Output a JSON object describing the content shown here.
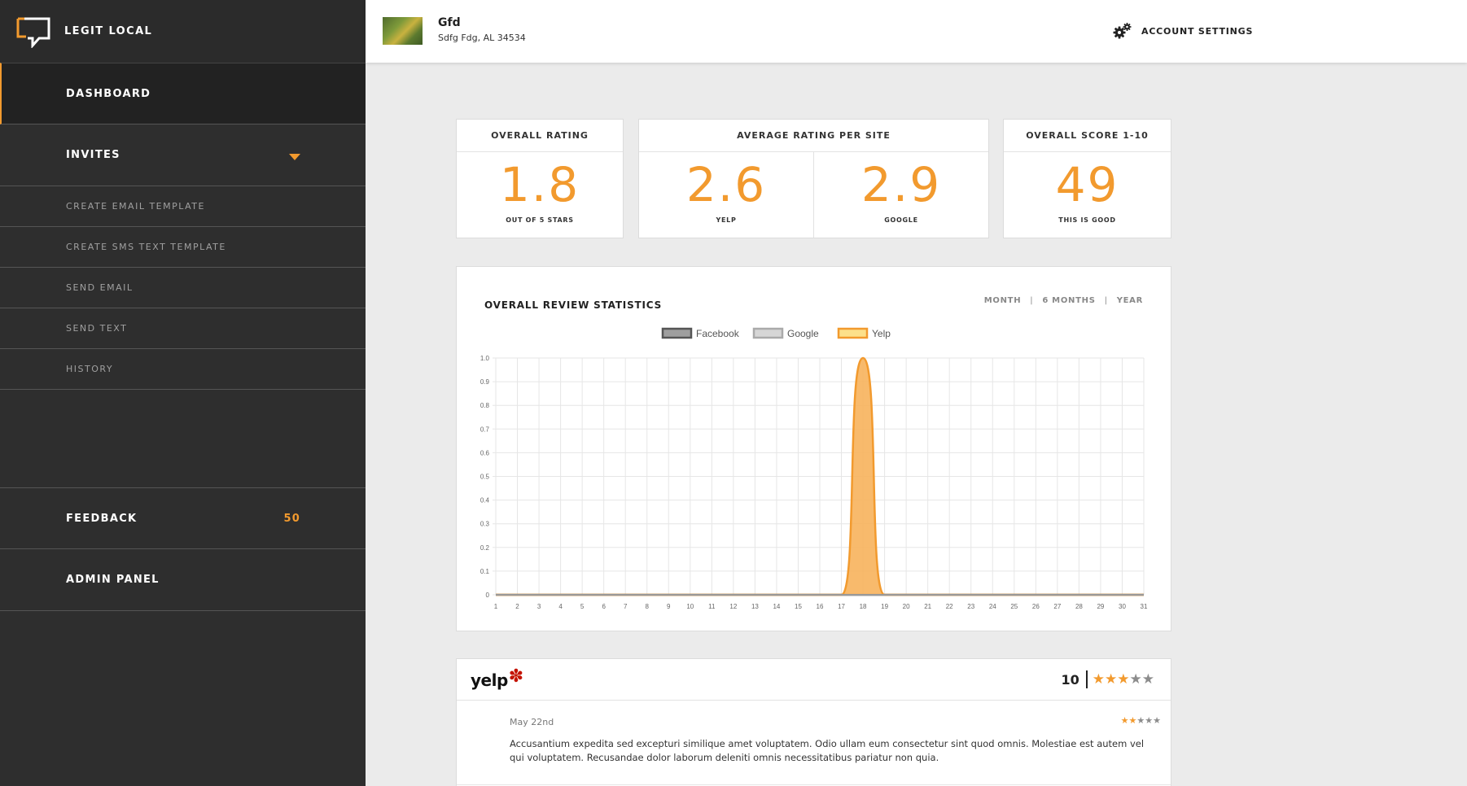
{
  "brand": {
    "name": "LEGIT LOCAL"
  },
  "sidebar": {
    "items": [
      {
        "label": "DASHBOARD"
      },
      {
        "label": "INVITES"
      },
      {
        "label": "CREATE EMAIL TEMPLATE"
      },
      {
        "label": "CREATE SMS TEXT TEMPLATE"
      },
      {
        "label": "SEND EMAIL"
      },
      {
        "label": "SEND TEXT"
      },
      {
        "label": "HISTORY"
      },
      {
        "label": "FEEDBACK",
        "badge": "50"
      },
      {
        "label": "ADMIN PANEL"
      }
    ]
  },
  "header": {
    "business_name": "Gfd",
    "business_address": "Sdfg Fdg, AL 34534",
    "account_settings": "ACCOUNT SETTINGS"
  },
  "cards": {
    "overall_rating": {
      "title": "OVERALL RATING",
      "value": "1.8",
      "caption": "OUT OF 5 STARS"
    },
    "average_per_site": {
      "title": "AVERAGE RATING PER SITE",
      "stats": [
        {
          "value": "2.6",
          "caption": "YELP"
        },
        {
          "value": "2.9",
          "caption": "GOOGLE"
        }
      ]
    },
    "overall_score": {
      "title": "OVERALL SCORE 1-10",
      "value": "49",
      "caption": "THIS IS GOOD"
    }
  },
  "stats_panel": {
    "title": "OVERALL REVIEW STATISTICS",
    "ranges": [
      "MONTH",
      "6 MONTHS",
      "YEAR"
    ]
  },
  "chart_data": {
    "type": "area",
    "title": "",
    "xlabel": "",
    "ylabel": "",
    "x": [
      1,
      2,
      3,
      4,
      5,
      6,
      7,
      8,
      9,
      10,
      11,
      12,
      13,
      14,
      15,
      16,
      17,
      18,
      19,
      20,
      21,
      22,
      23,
      24,
      25,
      26,
      27,
      28,
      29,
      30,
      31
    ],
    "ylim": [
      0,
      1
    ],
    "yticks": [
      "0",
      "0.1",
      "0.2",
      "0.3",
      "0.4",
      "0.5",
      "0.6",
      "0.7",
      "0.8",
      "0.9",
      "1.0"
    ],
    "grid": true,
    "legend_position": "top-center",
    "series": [
      {
        "name": "Facebook",
        "color": "#555555",
        "fill": "#9e9e9e",
        "values": [
          0,
          0,
          0,
          0,
          0,
          0,
          0,
          0,
          0,
          0,
          0,
          0,
          0,
          0,
          0,
          0,
          0,
          0,
          0,
          0,
          0,
          0,
          0,
          0,
          0,
          0,
          0,
          0,
          0,
          0,
          0
        ]
      },
      {
        "name": "Google",
        "color": "#aaaaaa",
        "fill": "#d6d6d6",
        "values": [
          0,
          0,
          0,
          0,
          0,
          0,
          0,
          0,
          0,
          0,
          0,
          0,
          0,
          0,
          0,
          0,
          0,
          0,
          0,
          0,
          0,
          0,
          0,
          0,
          0,
          0,
          0,
          0,
          0,
          0,
          0
        ]
      },
      {
        "name": "Yelp",
        "color": "#f29a2e",
        "fill": "#f7b25c",
        "legend_fill": "#fce08a",
        "values": [
          0,
          0,
          0,
          0,
          0,
          0,
          0,
          0,
          0,
          0,
          0,
          0,
          0,
          0,
          0,
          0,
          0,
          1,
          0,
          0,
          0,
          0,
          0,
          0,
          0,
          0,
          0,
          0,
          0,
          0,
          0
        ]
      }
    ]
  },
  "review_panel": {
    "site": "yelp",
    "score": "10",
    "stars": 3,
    "max_stars": 5,
    "review": {
      "date": "May 22nd",
      "stars": 2,
      "text": "Accusantium expedita sed excepturi similique amet voluptatem. Odio ullam eum consectetur sint quod omnis. Molestiae est autem vel qui voluptatem. Recusandae dolor laborum deleniti omnis necessitatibus pariatur non quia."
    }
  },
  "colors": {
    "accent": "#f29a2e",
    "sidebar_bg": "#2e2e2e",
    "page_bg": "#ebebeb"
  }
}
